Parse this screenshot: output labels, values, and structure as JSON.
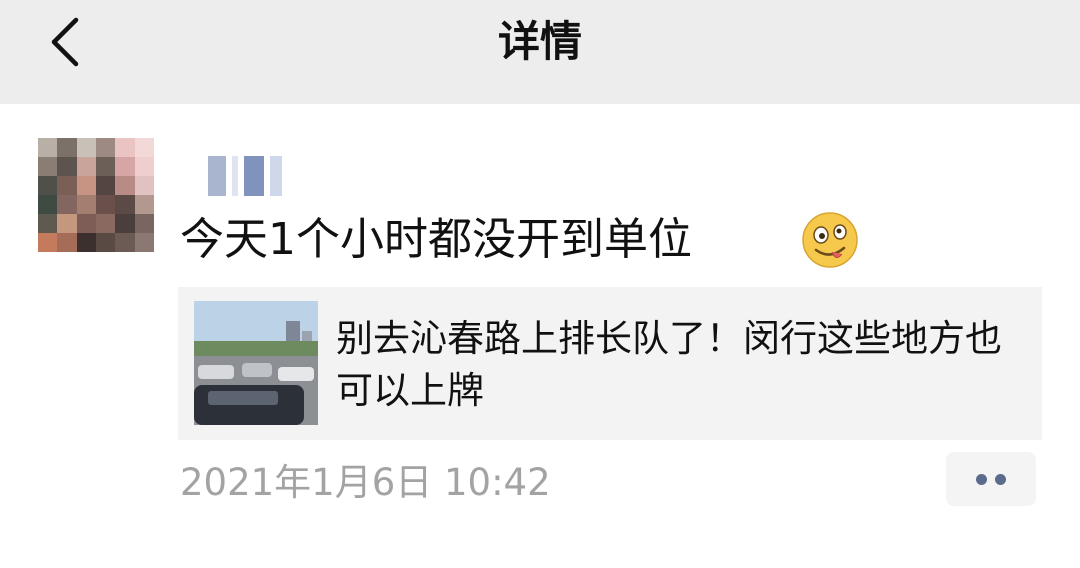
{
  "header": {
    "title": "详情",
    "back_icon": "chevron-left-icon"
  },
  "post": {
    "text": "今天1个小时都没开到单位",
    "emoji": "crazy-face-emoji",
    "link_card": {
      "title": "别去沁春路上排长队了！闵行这些地方也可以上牌",
      "thumbnail": "parking-lot-photo"
    },
    "timestamp": "2021年1月6日 10:42",
    "more_icon": "more-dots-icon"
  },
  "colors": {
    "nav_bg": "#ededed",
    "card_bg": "#f3f3f3",
    "timestamp": "#a3a3a3",
    "dots": "#5b6b8c"
  }
}
